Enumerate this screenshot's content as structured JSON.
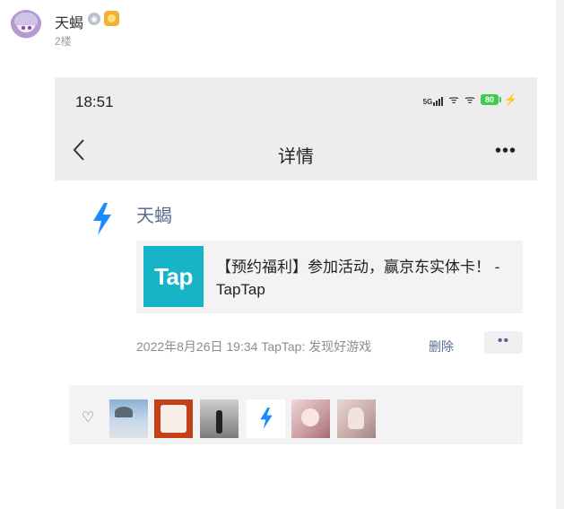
{
  "comment": {
    "username": "天蝎",
    "floor": "2楼"
  },
  "phone": {
    "status_bar": {
      "time": "18:51",
      "network": "5G",
      "battery": "80"
    },
    "nav": {
      "title": "详情",
      "back_icon": "chevron-left-icon",
      "more_icon": "more-dots-icon"
    },
    "post": {
      "author": "天蝎",
      "app_icon": "lightning-icon",
      "link_card": {
        "logo_text": "Tap",
        "title": "【预约福利】参加活动，赢京东实体卡！ - TapTap"
      },
      "meta": "2022年8月26日 19:34  TapTap: 发现好游戏",
      "delete_label": "删除"
    },
    "likes": {
      "icon": "heart-icon",
      "avatars": [
        "like-avatar-1",
        "like-avatar-2",
        "like-avatar-3",
        "like-avatar-4",
        "like-avatar-5",
        "like-avatar-6"
      ]
    }
  },
  "colors": {
    "tap_brand": "#17b3c7",
    "link_blue": "#5a6f96",
    "lightning_blue": "#1a8cff",
    "battery_green": "#3ecb4f"
  }
}
